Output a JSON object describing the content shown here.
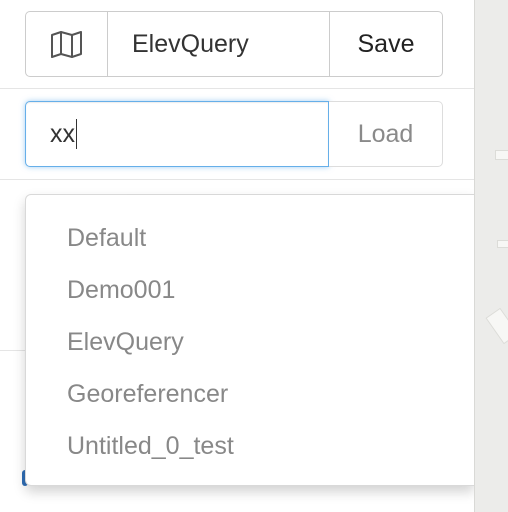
{
  "toolbar": {
    "map_icon": "map-icon",
    "current_name": "ElevQuery",
    "save_label": "Save"
  },
  "load": {
    "input_value": "xx",
    "load_label": "Load"
  },
  "dropdown": {
    "items": [
      {
        "label": "Default"
      },
      {
        "label": "Demo001"
      },
      {
        "label": "ElevQuery"
      },
      {
        "label": "Georeferencer"
      },
      {
        "label": "Untitled_0_test"
      }
    ]
  },
  "colors": {
    "focus_border": "#66afe9",
    "border": "#cccccc",
    "menu_text": "#888888"
  }
}
